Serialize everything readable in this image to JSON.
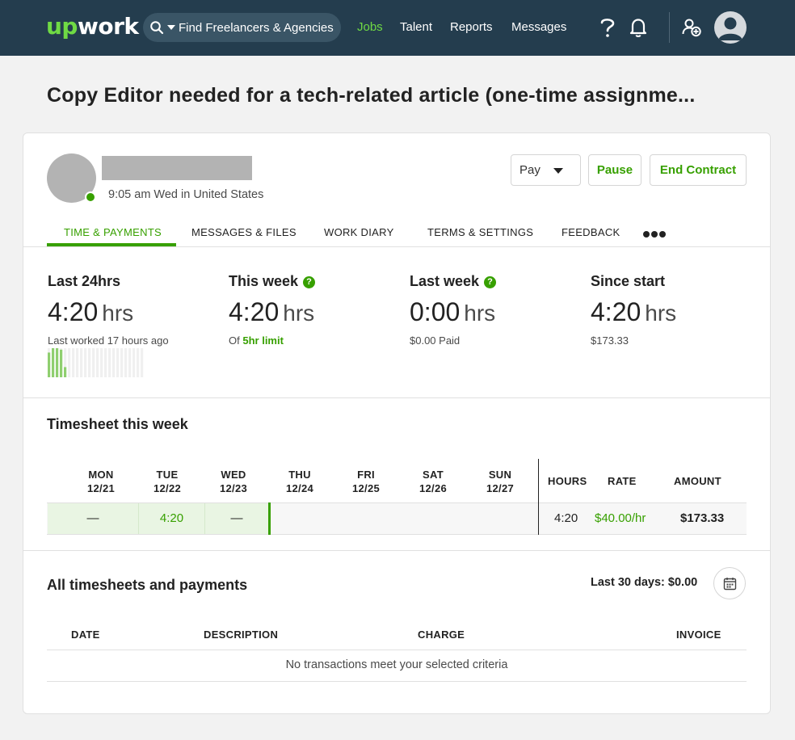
{
  "nav": {
    "logo_up": "up",
    "logo_work": "work",
    "search_placeholder": "Find Freelancers & Agencies",
    "links": [
      "Jobs",
      "Talent",
      "Reports",
      "Messages"
    ],
    "active_link": "Jobs",
    "help_icon": "question-icon",
    "notifications_icon": "bell-icon",
    "add_team_icon": "add-user-icon",
    "avatar_icon": "user-avatar-icon"
  },
  "page": {
    "title": "Copy Editor needed for a tech-related article (one-time assignme..."
  },
  "contract": {
    "local_time": "9:05 am Wed in United States",
    "status": "online",
    "buttons": {
      "pay": "Pay",
      "pause": "Pause",
      "end": "End Contract"
    }
  },
  "tabs": {
    "items": [
      "TIME & PAYMENTS",
      "MESSAGES & FILES",
      "WORK DIARY",
      "TERMS & SETTINGS",
      "FEEDBACK"
    ],
    "active": "TIME & PAYMENTS",
    "more_icon": "more-dots-icon"
  },
  "stats": {
    "last24": {
      "label": "Last 24hrs",
      "value": "4:20",
      "unit": "hrs",
      "sub": "Last worked 17 hours ago"
    },
    "this_week": {
      "label": "This week",
      "value": "4:20",
      "unit": "hrs",
      "sub_prefix": "Of",
      "sub_link": "5hr limit"
    },
    "last_week": {
      "label": "Last week",
      "value": "0:00",
      "unit": "hrs",
      "sub": "$0.00 Paid"
    },
    "since_start": {
      "label": "Since start",
      "value": "4:20",
      "unit": "hrs",
      "sub": "$173.33"
    },
    "sparkline_levels": [
      0.85,
      1.0,
      1.0,
      0.95,
      0.35,
      0,
      0,
      0,
      0,
      0,
      0,
      0,
      0,
      0,
      0,
      0,
      0,
      0,
      0,
      0,
      0,
      0,
      0,
      0
    ]
  },
  "timesheet": {
    "title": "Timesheet this week",
    "days": [
      {
        "day": "MON",
        "date": "12/21",
        "value": "—"
      },
      {
        "day": "TUE",
        "date": "12/22",
        "value": "4:20"
      },
      {
        "day": "WED",
        "date": "12/23",
        "value": "—"
      },
      {
        "day": "THU",
        "date": "12/24",
        "value": ""
      },
      {
        "day": "FRI",
        "date": "12/25",
        "value": ""
      },
      {
        "day": "SAT",
        "date": "12/26",
        "value": ""
      },
      {
        "day": "SUN",
        "date": "12/27",
        "value": ""
      }
    ],
    "headers": {
      "hours": "HOURS",
      "rate": "RATE",
      "amount": "AMOUNT"
    },
    "hours": "4:20",
    "rate": "$40.00/hr",
    "amount": "$173.33"
  },
  "payments": {
    "title": "All timesheets and payments",
    "last30": "Last 30 days: $0.00",
    "calendar_icon": "calendar-icon",
    "columns": [
      "DATE",
      "DESCRIPTION",
      "CHARGE",
      "INVOICE"
    ],
    "empty_message": "No transactions meet your selected criteria"
  },
  "colors": {
    "nav_bg": "#243d4e",
    "brand_green": "#37a000",
    "nav_green": "#6fda44",
    "placeholder_gray": "#b3b3b3"
  }
}
